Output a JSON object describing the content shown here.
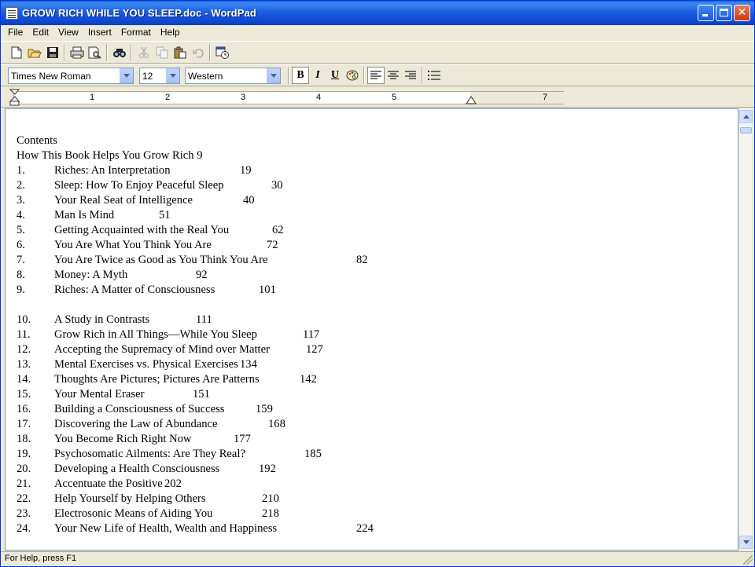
{
  "window": {
    "title": "GROW RICH WHILE YOU SLEEP.doc - WordPad",
    "controls": {
      "minimize": "minimize",
      "maximize": "maximize",
      "close": "✕"
    }
  },
  "menu": [
    "File",
    "Edit",
    "View",
    "Insert",
    "Format",
    "Help"
  ],
  "toolbar": {
    "icons": [
      "new-icon",
      "open-icon",
      "save-icon",
      "print-icon",
      "print-preview-icon",
      "find-icon",
      "cut-icon",
      "copy-icon",
      "paste-icon",
      "undo-icon",
      "date-time-icon"
    ]
  },
  "format_bar": {
    "font": "Times New Roman",
    "size": "12",
    "script": "Western",
    "bold": "B",
    "italic": "I",
    "underline": "U"
  },
  "ruler": {
    "marks": [
      "1",
      "2",
      "3",
      "4",
      "5",
      "7"
    ]
  },
  "document": {
    "heading": "Contents",
    "intro": "How This Book Helps You Grow Rich 9",
    "entries": [
      {
        "n": "1.",
        "t": "Riches: An Interpretation",
        "p": "19"
      },
      {
        "n": "2.",
        "t": "Sleep: How To Enjoy Peaceful Sleep",
        "p": "30"
      },
      {
        "n": "3.",
        "t": "Your Real Seat of Intelligence",
        "p": "40"
      },
      {
        "n": "4.",
        "t": "Man Is Mind",
        "p": "51"
      },
      {
        "n": "5.",
        "t": "Getting Acquainted with the Real You",
        "p": "62"
      },
      {
        "n": "6.",
        "t": "You Are What You Think You Are",
        "p": "72"
      },
      {
        "n": "7.",
        "t": "You Are Twice as Good as You Think You Are",
        "p": "82"
      },
      {
        "n": "8.",
        "t": "Money: A Myth",
        "p": "92"
      },
      {
        "n": "9.",
        "t": "Riches: A Matter of Consciousness",
        "p": "101"
      },
      {
        "n": "10.",
        "t": "A Study in Contrasts",
        "p": "111"
      },
      {
        "n": "11.",
        "t": "Grow Rich in All Things—While You Sleep",
        "p": "117"
      },
      {
        "n": "12.",
        "t": "Accepting the Supremacy of Mind over Matter",
        "p": "127"
      },
      {
        "n": "13.",
        "t": "Mental Exercises vs. Physical Exercises",
        "p": "134"
      },
      {
        "n": "14.",
        "t": "Thoughts Are Pictures; Pictures Are Patterns",
        "p": "142"
      },
      {
        "n": "15.",
        "t": "Your Mental Eraser",
        "p": "151"
      },
      {
        "n": "16.",
        "t": "Building a Consciousness of Success",
        "p": "159"
      },
      {
        "n": "17.",
        "t": "Discovering the Law of Abundance",
        "p": "168"
      },
      {
        "n": "18.",
        "t": "You Become Rich Right Now",
        "p": "177"
      },
      {
        "n": "19.",
        "t": "Psychosomatic Ailments: Are They Real?",
        "p": "185"
      },
      {
        "n": "20.",
        "t": "Developing a Health Consciousness",
        "p": "192"
      },
      {
        "n": "21.",
        "t": "Accentuate the Positive",
        "p": "202"
      },
      {
        "n": "22.",
        "t": "Help Yourself by Helping Others",
        "p": "210"
      },
      {
        "n": "23.",
        "t": "Electrosonic Means of Aiding You",
        "p": "218"
      },
      {
        "n": "24.",
        "t": "Your New Life of Health, Wealth and Happiness",
        "p": "224"
      }
    ]
  },
  "status": {
    "text": "For Help, press F1"
  },
  "colors": {
    "titlebar": "#0b55d8",
    "chrome": "#ece9d8",
    "page": "#ffffff"
  }
}
